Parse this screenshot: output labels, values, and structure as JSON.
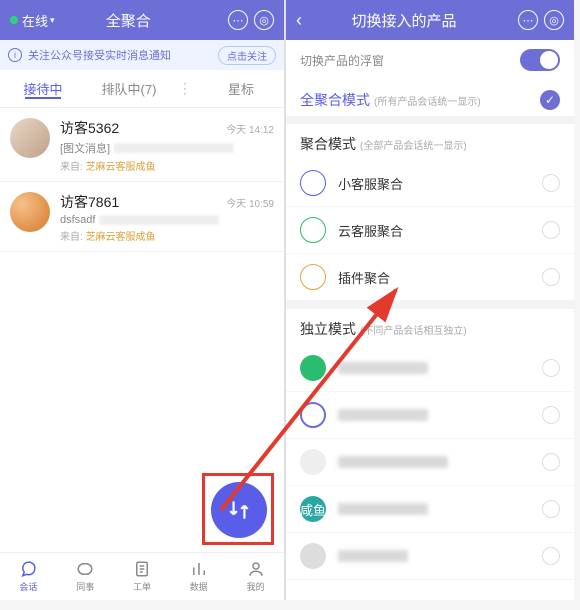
{
  "left": {
    "status": "在线",
    "title": "全聚合",
    "notice_text": "关注公众号接受实时消息通知",
    "notice_btn": "点击关注",
    "tabs": {
      "receiving": "接待中",
      "queue": "排队中(7)",
      "star": "星标"
    },
    "conversations": [
      {
        "name": "访客5362",
        "time": "今天 14:12",
        "msg_prefix": "[图文消息]",
        "src_lbl": "来自:",
        "src": "芝麻云客服成鱼"
      },
      {
        "name": "访客7861",
        "time": "今天 10:59",
        "msg_prefix": "dsfsadf",
        "src_lbl": "来自:",
        "src": "芝麻云客服成鱼"
      }
    ],
    "nav": {
      "chat": "会话",
      "colleague": "同事",
      "ticket": "工单",
      "data": "数据",
      "mine": "我的"
    }
  },
  "right": {
    "title": "切换接入的产品",
    "float_label": "切换产品的浮窗",
    "all_mode": {
      "title": "全聚合模式",
      "sub": "(所有产品会话统一显示)"
    },
    "agg_mode": {
      "title": "聚合模式",
      "sub": "(全部产品会话统一显示)",
      "opts": [
        "小客服聚合",
        "云客服聚合",
        "插件聚合"
      ]
    },
    "ind_mode": {
      "title": "独立模式",
      "sub": "(不同产品会话相互独立)",
      "teal_label": "咸鱼"
    }
  }
}
